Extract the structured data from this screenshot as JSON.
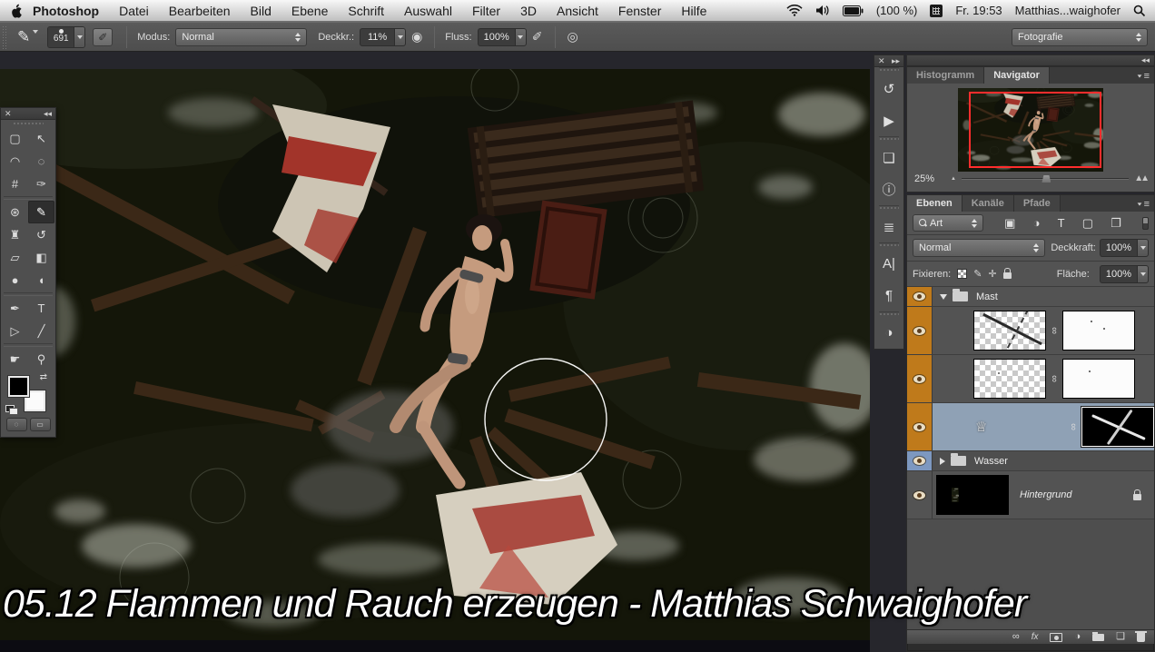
{
  "menu_bar": {
    "items": [
      "Photoshop",
      "Datei",
      "Bearbeiten",
      "Bild",
      "Ebene",
      "Schrift",
      "Auswahl",
      "Filter",
      "3D",
      "Ansicht",
      "Fenster",
      "Hilfe"
    ],
    "status": {
      "battery": "(100 %)",
      "clock": "Fr. 19:53",
      "user": "Matthias...waighofer"
    }
  },
  "options_bar": {
    "brush_size": "691",
    "mode_label": "Modus:",
    "mode_value": "Normal",
    "opacity_label": "Deckkr.:",
    "opacity_value": "11%",
    "flow_label": "Fluss:",
    "flow_value": "100%",
    "workspace": "Fotografie"
  },
  "toolbar": {
    "tools": [
      {
        "name": "rectangular-marquee",
        "glyph": "▢"
      },
      {
        "name": "move",
        "glyph": "↖"
      },
      {
        "name": "lasso",
        "glyph": "◠"
      },
      {
        "name": "quick-selection",
        "glyph": "◌"
      },
      {
        "name": "crop",
        "glyph": "#"
      },
      {
        "name": "eyedropper",
        "glyph": "✑"
      },
      {
        "name": "healing-brush",
        "glyph": "⊛"
      },
      {
        "name": "brush",
        "glyph": "✎",
        "selected": true
      },
      {
        "name": "clone-stamp",
        "glyph": "♜"
      },
      {
        "name": "history-brush",
        "glyph": "↺"
      },
      {
        "name": "eraser",
        "glyph": "▱"
      },
      {
        "name": "gradient",
        "glyph": "◧"
      },
      {
        "name": "blur",
        "glyph": "●"
      },
      {
        "name": "dodge",
        "glyph": "◖"
      },
      {
        "name": "pen",
        "glyph": "✒"
      },
      {
        "name": "type",
        "glyph": "T"
      },
      {
        "name": "path-selection",
        "glyph": "▷"
      },
      {
        "name": "line",
        "glyph": "╱"
      },
      {
        "name": "hand",
        "glyph": "☛"
      },
      {
        "name": "zoom",
        "glyph": "⚲"
      }
    ]
  },
  "dock_strip": {
    "icons": [
      {
        "name": "history",
        "glyph": "↺"
      },
      {
        "name": "actions",
        "glyph": "▶"
      },
      {
        "name": "layer-comps",
        "glyph": "❏"
      },
      {
        "name": "info",
        "glyph": "ⓘ"
      },
      {
        "name": "character-styles",
        "glyph": "≣"
      },
      {
        "name": "character",
        "glyph": "A|"
      },
      {
        "name": "paragraph",
        "glyph": "¶"
      },
      {
        "name": "adjustments",
        "glyph": "◑"
      }
    ]
  },
  "navigator": {
    "tab_histogram": "Histogramm",
    "tab_navigator": "Navigator",
    "zoom_value": "25%"
  },
  "layers_panel": {
    "tab_layers": "Ebenen",
    "tab_channels": "Kanäle",
    "tab_paths": "Pfade",
    "filter_value": "Art",
    "blend_mode": "Normal",
    "opacity_label": "Deckkraft:",
    "opacity_value": "100%",
    "lock_label": "Fixieren:",
    "fill_label": "Fläche:",
    "fill_value": "100%",
    "group_mast": "Mast",
    "group_wasser": "Wasser",
    "background_name": "Hintergrund"
  },
  "icons": {
    "collapse_left": "◂◂",
    "collapse_right": "▸▸",
    "close": "✕",
    "chain": "∞",
    "fx": "fx",
    "adjustment": "◑",
    "new_layer": "❏",
    "image_filter": "▣",
    "shape_filter": "▢",
    "smart_filter": "❐",
    "type_filter": "T",
    "brush_lock": "✎",
    "move_lock": "✛",
    "swap_colors": "⇄",
    "small_thumb": "♕",
    "airbrush_pressure": "◉",
    "airbrush": "✐",
    "pressure_size": "◎",
    "brush_tool": "✎",
    "brush_panel_toggle": "✐"
  },
  "caption": "05.12 Flammen und Rauch erzeugen - Matthias Schwaighofer",
  "colors": {
    "eye_column_orange": "#bf7a1b",
    "selected_row_blue": "#8fa1b5",
    "wasser_eye_blue": "#7d98c0",
    "navigator_frame_red": "#ff2d2d"
  }
}
